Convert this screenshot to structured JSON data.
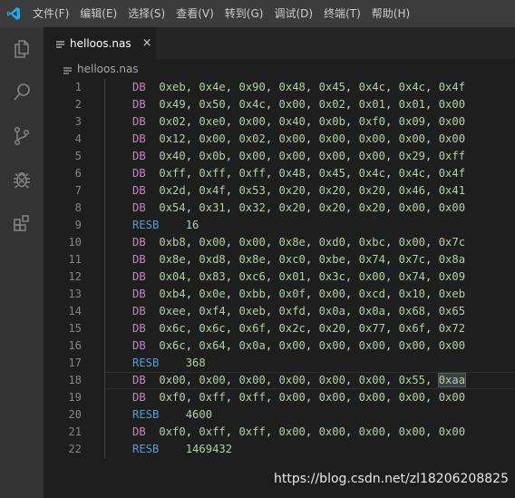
{
  "menu": {
    "items": [
      "文件(F)",
      "编辑(E)",
      "选择(S)",
      "查看(V)",
      "转到(G)",
      "调试(D)",
      "终端(T)",
      "帮助(H)"
    ]
  },
  "tab": {
    "label": "helloos.nas",
    "close": "×"
  },
  "breadcrumb": {
    "label": "helloos.nas"
  },
  "editor": {
    "lines": [
      {
        "n": "1",
        "kw": "DB",
        "args": [
          "0xeb",
          "0x4e",
          "0x90",
          "0x48",
          "0x45",
          "0x4c",
          "0x4c",
          "0x4f"
        ]
      },
      {
        "n": "2",
        "kw": "DB",
        "args": [
          "0x49",
          "0x50",
          "0x4c",
          "0x00",
          "0x02",
          "0x01",
          "0x01",
          "0x00"
        ]
      },
      {
        "n": "3",
        "kw": "DB",
        "args": [
          "0x02",
          "0xe0",
          "0x00",
          "0x40",
          "0x0b",
          "0xf0",
          "0x09",
          "0x00"
        ]
      },
      {
        "n": "4",
        "kw": "DB",
        "args": [
          "0x12",
          "0x00",
          "0x02",
          "0x00",
          "0x00",
          "0x00",
          "0x00",
          "0x00"
        ]
      },
      {
        "n": "5",
        "kw": "DB",
        "args": [
          "0x40",
          "0x0b",
          "0x00",
          "0x00",
          "0x00",
          "0x00",
          "0x29",
          "0xff"
        ]
      },
      {
        "n": "6",
        "kw": "DB",
        "args": [
          "0xff",
          "0xff",
          "0xff",
          "0x48",
          "0x45",
          "0x4c",
          "0x4c",
          "0x4f"
        ]
      },
      {
        "n": "7",
        "kw": "DB",
        "args": [
          "0x2d",
          "0x4f",
          "0x53",
          "0x20",
          "0x20",
          "0x20",
          "0x46",
          "0x41"
        ]
      },
      {
        "n": "8",
        "kw": "DB",
        "args": [
          "0x54",
          "0x31",
          "0x32",
          "0x20",
          "0x20",
          "0x20",
          "0x00",
          "0x00"
        ]
      },
      {
        "n": "9",
        "kw": "RESB",
        "args": [
          "16"
        ]
      },
      {
        "n": "10",
        "kw": "DB",
        "args": [
          "0xb8",
          "0x00",
          "0x00",
          "0x8e",
          "0xd0",
          "0xbc",
          "0x00",
          "0x7c"
        ]
      },
      {
        "n": "11",
        "kw": "DB",
        "args": [
          "0x8e",
          "0xd8",
          "0x8e",
          "0xc0",
          "0xbe",
          "0x74",
          "0x7c",
          "0x8a"
        ]
      },
      {
        "n": "12",
        "kw": "DB",
        "args": [
          "0x04",
          "0x83",
          "0xc6",
          "0x01",
          "0x3c",
          "0x00",
          "0x74",
          "0x09"
        ]
      },
      {
        "n": "13",
        "kw": "DB",
        "args": [
          "0xb4",
          "0x0e",
          "0xbb",
          "0x0f",
          "0x00",
          "0xcd",
          "0x10",
          "0xeb"
        ]
      },
      {
        "n": "14",
        "kw": "DB",
        "args": [
          "0xee",
          "0xf4",
          "0xeb",
          "0xfd",
          "0x0a",
          "0x0a",
          "0x68",
          "0x65"
        ]
      },
      {
        "n": "15",
        "kw": "DB",
        "args": [
          "0x6c",
          "0x6c",
          "0x6f",
          "0x2c",
          "0x20",
          "0x77",
          "0x6f",
          "0x72"
        ]
      },
      {
        "n": "16",
        "kw": "DB",
        "args": [
          "0x6c",
          "0x64",
          "0x0a",
          "0x00",
          "0x00",
          "0x00",
          "0x00",
          "0x00"
        ]
      },
      {
        "n": "17",
        "kw": "RESB",
        "args": [
          "368"
        ]
      },
      {
        "n": "18",
        "kw": "DB",
        "args": [
          "0x00",
          "0x00",
          "0x00",
          "0x00",
          "0x00",
          "0x00",
          "0x55",
          "0xaa"
        ],
        "current": true,
        "highlight_last": true
      },
      {
        "n": "19",
        "kw": "DB",
        "args": [
          "0xf0",
          "0xff",
          "0xff",
          "0x00",
          "0x00",
          "0x00",
          "0x00",
          "0x00"
        ]
      },
      {
        "n": "20",
        "kw": "RESB",
        "args": [
          "4600"
        ]
      },
      {
        "n": "21",
        "kw": "DB",
        "args": [
          "0xf0",
          "0xff",
          "0xff",
          "0x00",
          "0x00",
          "0x00",
          "0x00",
          "0x00"
        ]
      },
      {
        "n": "22",
        "kw": "RESB",
        "args": [
          "1469432"
        ]
      }
    ]
  },
  "watermark": "https://blog.csdn.net/zl18206208825",
  "colors": {
    "accent": "#0078d4",
    "db_keyword": "#c586c0",
    "resb_keyword": "#569cd6",
    "number": "#b5cea8"
  },
  "icons": {
    "app": "vscode-logo-icon",
    "activity": [
      "explorer-icon",
      "search-icon",
      "source-control-icon",
      "debug-icon",
      "extensions-icon"
    ]
  }
}
